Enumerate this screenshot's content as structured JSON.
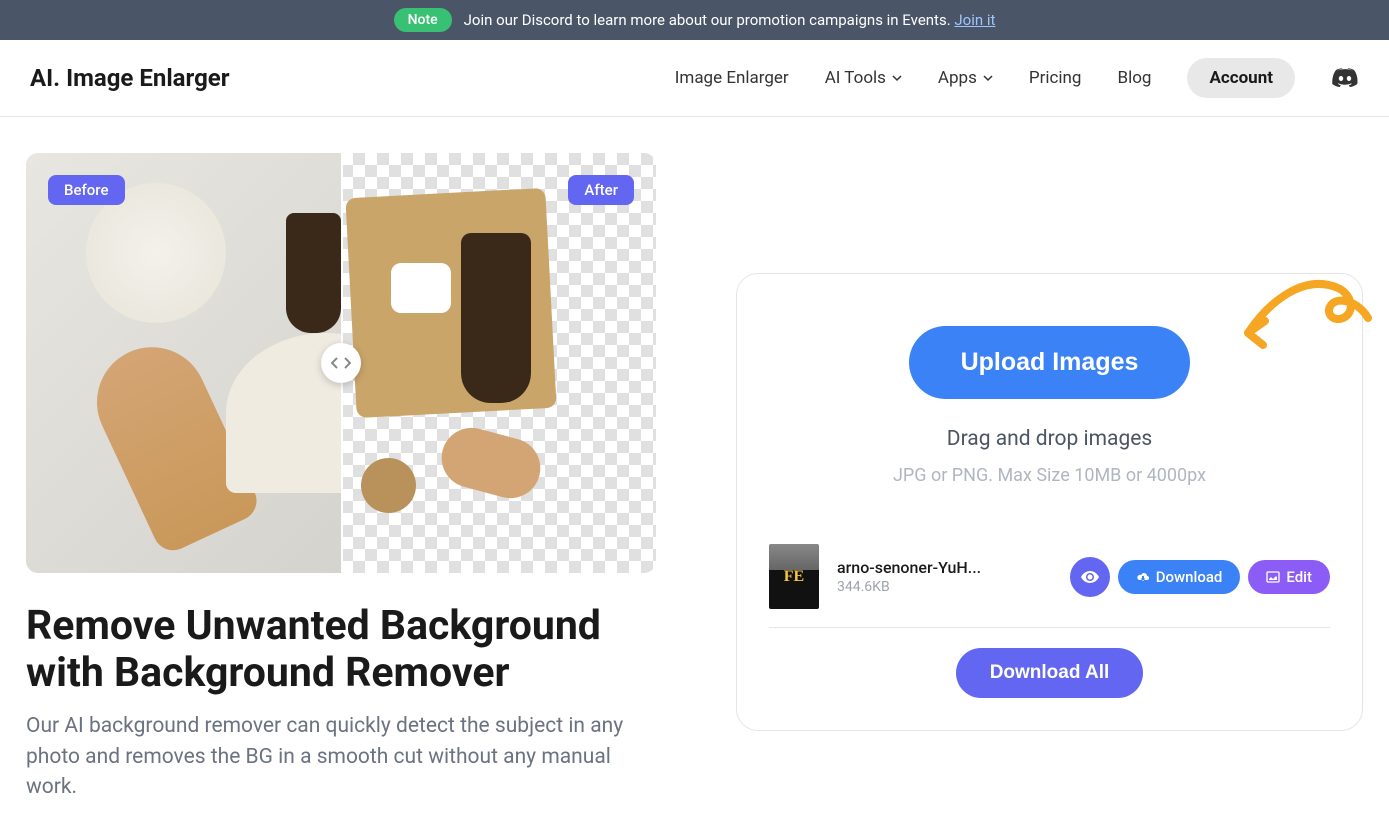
{
  "banner": {
    "badge": "Note",
    "text": "Join our Discord to learn more about our promotion campaigns in Events.",
    "link": "Join it"
  },
  "header": {
    "logo": "AI. Image Enlarger",
    "nav": {
      "image_enlarger": "Image Enlarger",
      "ai_tools": "AI Tools",
      "apps": "Apps",
      "pricing": "Pricing",
      "blog": "Blog",
      "account": "Account"
    }
  },
  "hero": {
    "before_badge": "Before",
    "after_badge": "After",
    "headline": "Remove Unwanted Background with Background Remover",
    "subtext": "Our AI background remover can quickly detect the subject in any photo and removes the BG in a smooth cut without any manual work."
  },
  "upload": {
    "button": "Upload Images",
    "drop_text": "Drag and drop images",
    "spec_text": "JPG or PNG. Max Size 10MB or 4000px",
    "file": {
      "name": "arno-senoner-YuH...",
      "size": "344.6KB",
      "thumb_text": "FE"
    },
    "actions": {
      "download": "Download",
      "edit": "Edit"
    },
    "download_all": "Download All"
  },
  "colors": {
    "primary_blue": "#3b82f6",
    "purple": "#6366f1",
    "violet": "#8b5cf6",
    "green": "#38c172",
    "banner_bg": "#4a5568",
    "arrow": "#f5a623"
  }
}
